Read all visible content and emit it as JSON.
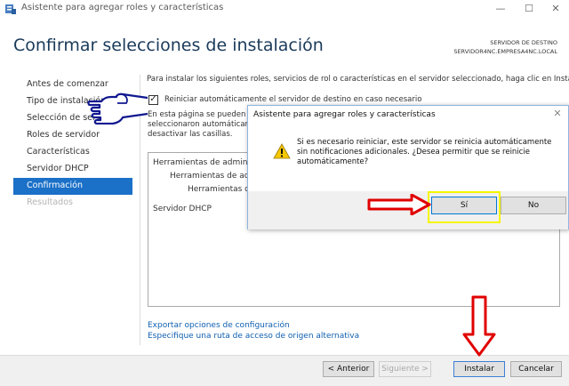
{
  "window": {
    "title": "Asistente para agregar roles y características",
    "minimize_glyph": "—",
    "maximize_glyph": "☐",
    "close_glyph": "✕"
  },
  "page": {
    "title": "Confirmar selecciones de instalación",
    "destination_label": "SERVIDOR DE DESTINO",
    "destination_server": "SERVIDOR4NC.EMPRESA4NC.LOCAL"
  },
  "nav": {
    "items": [
      {
        "label": "Antes de comenzar",
        "state": "normal"
      },
      {
        "label": "Tipo de instalación",
        "state": "normal"
      },
      {
        "label": "Selección de servidor",
        "state": "normal"
      },
      {
        "label": "Roles de servidor",
        "state": "normal"
      },
      {
        "label": "Características",
        "state": "normal"
      },
      {
        "label": "Servidor DHCP",
        "state": "normal"
      },
      {
        "label": "Confirmación",
        "state": "active"
      },
      {
        "label": "Resultados",
        "state": "disabled"
      }
    ]
  },
  "content": {
    "intro": "Para instalar los siguientes roles, servicios de rol o características en el servidor seleccionado, haga clic en Instalar.",
    "restart_checkbox": {
      "label": "Reiniciar automáticamente el servidor de destino en caso necesario",
      "checked": true,
      "check_glyph": "✓"
    },
    "info_lines": [
      "En esta página se pueden m",
      "seleccionaron automáticame",
      "desactivar las casillas."
    ],
    "results": [
      {
        "text": "Herramientas de administ",
        "indent": 0
      },
      {
        "text": "Herramientas de admi",
        "indent": 1
      },
      {
        "text": "Herramientas del",
        "indent": 2
      },
      {
        "text": "Servidor DHCP",
        "indent": 0
      }
    ],
    "links": {
      "export": "Exportar opciones de configuración",
      "alt_source": "Especifique una ruta de acceso de origen alternativa"
    }
  },
  "footer": {
    "back": "< Anterior",
    "next": "Siguiente >",
    "install": "Instalar",
    "cancel": "Cancelar"
  },
  "dialog": {
    "title": "Asistente para agregar roles y características",
    "close_glyph": "✕",
    "message": "Si es necesario reiniciar, este servidor se reinicia automáticamente sin notificaciones adicionales. ¿Desea permitir que se reinicie automáticamente?",
    "yes": "Sí",
    "no": "No"
  },
  "colors": {
    "accent": "#1b70c8",
    "title": "#1a3a5a",
    "link": "#1060b0",
    "annotation_red": "#e00000",
    "annotation_yellow": "#f5f500",
    "hand_blue": "#101890"
  }
}
